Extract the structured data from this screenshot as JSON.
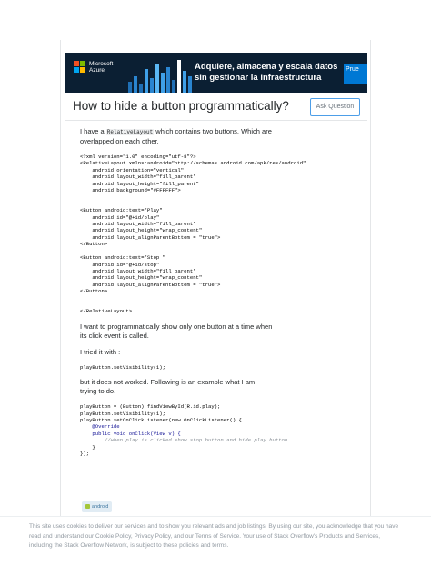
{
  "ad": {
    "brand_line1": "Microsoft",
    "brand_line2": "Azure",
    "headline_line1": "Adquiere, almacena y escala datos",
    "headline_line2": "sin gestionar la infraestructura",
    "cta_label": "Prue",
    "colors": {
      "background": "#0b1f33",
      "cta": "#0078d4"
    }
  },
  "question": {
    "title": "How to hide a button programmatically?",
    "ask_button": "Ask Question"
  },
  "post": {
    "intro_part1": "I have a",
    "intro_code": "RelativeLayout",
    "intro_part2": "which contains two buttons. Which are overlapped on each other.",
    "xml_lines": [
      "<?xml version=\"1.0\" encoding=\"utf-8\"?>",
      "<RelativeLayout xmlns:android=\"http://schemas.android.com/apk/res/android\"",
      "    android:orientation=\"vertical\"",
      "    android:layout_width=\"fill_parent\"",
      "    android:layout_height=\"fill_parent\"",
      "    android:background=\"#FFFFFF\">",
      "",
      "",
      "<Button android:text=\"Play\"",
      "    android:id=\"@+id/play\"",
      "    android:layout_width=\"fill_parent\"",
      "    android:layout_height=\"wrap_content\"",
      "    android:layout_alignParentBottom = \"true\">",
      "</Button>",
      "",
      "<Button android:text=\"Stop \"",
      "    android:id=\"@+id/stop\"",
      "    android:layout_width=\"fill_parent\"",
      "    android:layout_height=\"wrap_content\"",
      "    android:layout_alignParentBottom = \"true\">",
      "</Button>",
      "",
      "",
      "</RelativeLayout>"
    ],
    "para2": "I want to programmatically show only one button at a time when its click event is called.",
    "para3": "I tried it with :",
    "code_line": "playButton.setVisibility(1);",
    "para4": "but it does not worked. Following is an example what I am trying to do.",
    "java_lines": [
      "playButton = (Button) findViewById(R.id.play);",
      "playButton.setVisibility(1);",
      "playButton.setOnClickListener(new OnClickListener() {",
      "    @Override",
      "    public void onClick(View v) {",
      "        //when play is clicked show stop button and hide play button",
      "    }",
      "});"
    ],
    "tags": [
      "android"
    ]
  },
  "cookie_notice": {
    "text": "This site uses cookies to deliver our services and to show you relevant ads and job listings. By using our site, you acknowledge that you have read and understand our Cookie Policy, Privacy Policy, and our Terms of Service. Your use of Stack Overflow's Products and Services, including the Stack Overflow Network, is subject to these policies and terms."
  }
}
